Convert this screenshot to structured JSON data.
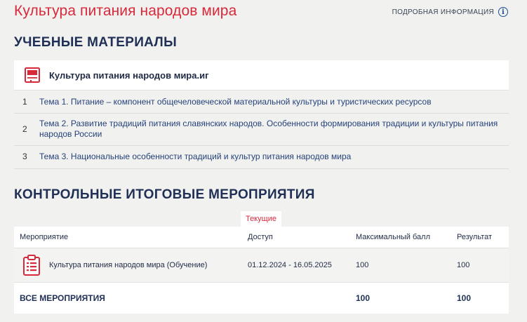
{
  "page": {
    "title": "Культура питания народов мира",
    "info_link": "ПОДРОБНАЯ ИНФОРМАЦИЯ",
    "info_icon": "info-circle-icon"
  },
  "materials": {
    "heading": "УЧЕБНЫЕ МАТЕРИАЛЫ",
    "course_title": "Культура питания народов мира.иг",
    "course_icon": "book-icon",
    "topics": [
      {
        "num": "1",
        "text": "Тема 1. Питание – компонент общечеловеческой материальной культуры и туристических ресурсов"
      },
      {
        "num": "2",
        "text": "Тема 2. Развитие традиций питания славянских народов. Особенности формирования традиции и культуры питания народов России"
      },
      {
        "num": "3",
        "text": "Тема 3. Национальные особенности традиций и культур питания народов мира"
      }
    ]
  },
  "events": {
    "heading": "КОНТРОЛЬНЫЕ ИТОГОВЫЕ МЕРОПРИЯТИЯ",
    "tab_label": "Текущие",
    "columns": [
      "Мероприятие",
      "Доступ",
      "Максимальный балл",
      "Результат"
    ],
    "rows": [
      {
        "name": "Культура питания народов мира (Обучение)",
        "access": "01.12.2024 - 16.05.2025",
        "max": "100",
        "result": "100",
        "icon": "clipboard-icon"
      }
    ],
    "total": {
      "label": "ВСЕ МЕРОПРИЯТИЯ",
      "max": "100",
      "result": "100"
    }
  },
  "colors": {
    "accent_red": "#d8293b",
    "heading_navy": "#1f2f55",
    "link_blue": "#25427a",
    "background": "#f1f1ef"
  }
}
